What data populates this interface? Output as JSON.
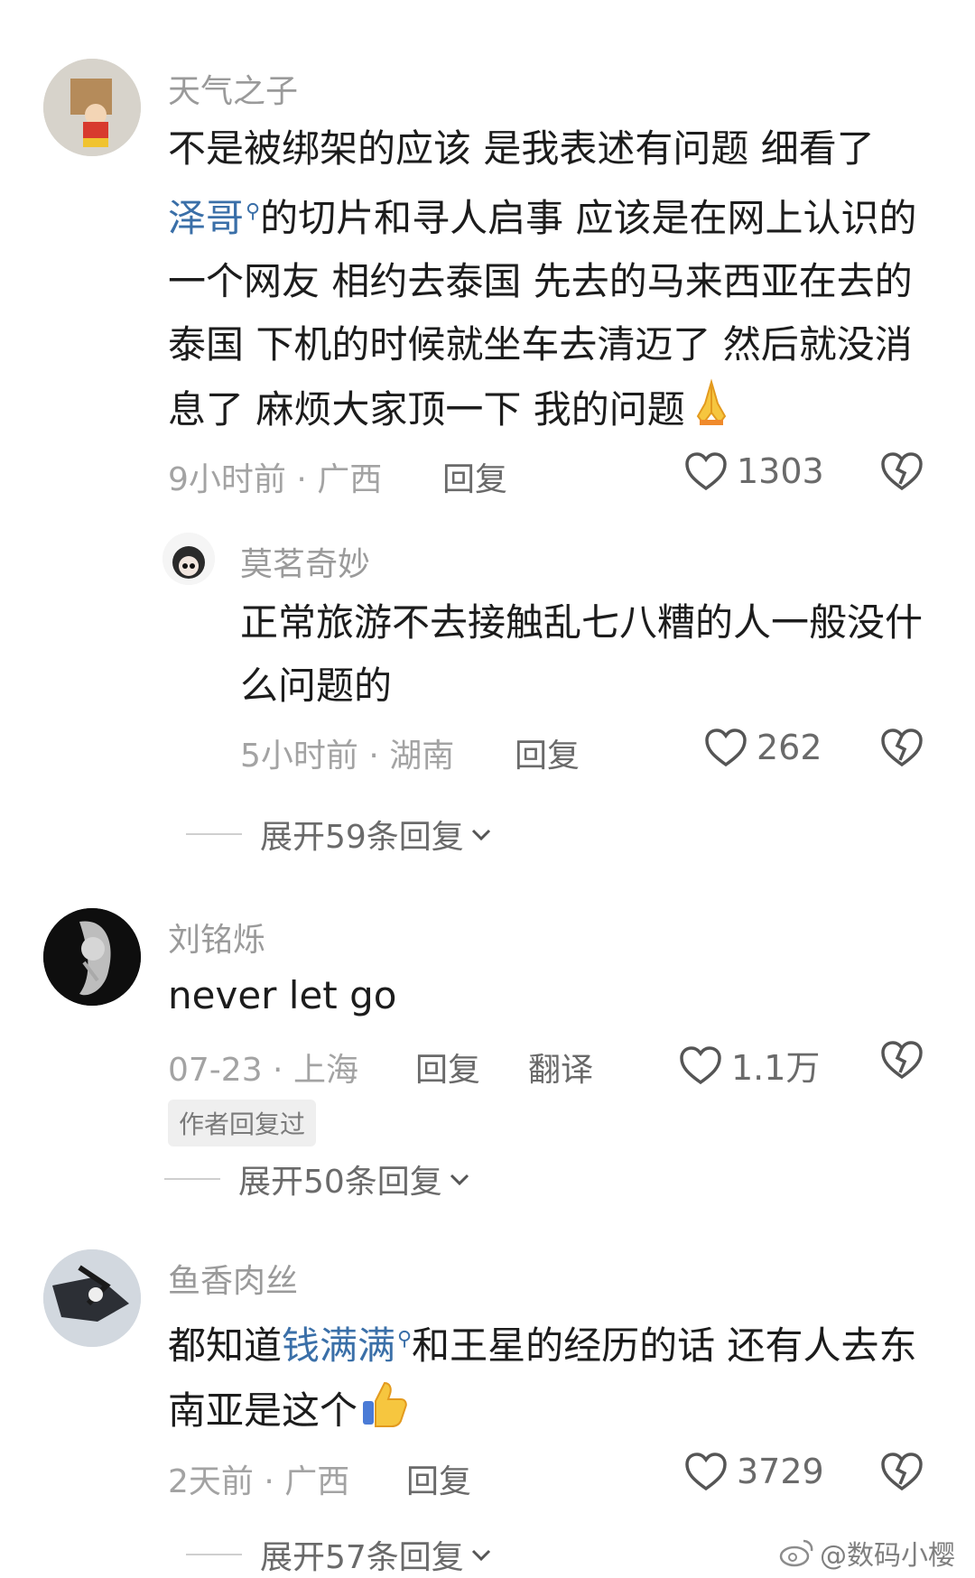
{
  "comments": [
    {
      "username": "天气之子",
      "text_before": "不是被绑架的应该 是我表述有问题 细看了",
      "mention": "泽哥",
      "text_after": "的切片和寻人启事 应该是在网上认识的一个网友 相约去泰国  先去的马来西亚在去的泰国 下机的时候就坐车去清迈了 然后就没消息了 麻烦大家顶一下 我的问题",
      "emoji": "pray-emoji",
      "meta": "9小时前 · 广西",
      "reply_label": "回复",
      "likes": "1303"
    },
    {
      "username": "莫茗奇妙",
      "text": "正常旅游不去接触乱七八糟的人一般没什么问题的",
      "meta": "5小时前 · 湖南",
      "reply_label": "回复",
      "likes": "262",
      "expand_label": "展开59条回复"
    },
    {
      "username": "刘铭烁",
      "text": "never let go",
      "meta": "07-23 · 上海",
      "reply_label": "回复",
      "translate_label": "翻译",
      "likes": "1.1万",
      "author_tag": "作者回复过",
      "expand_label": "展开50条回复"
    },
    {
      "username": "鱼香肉丝",
      "text_before": "都知道",
      "mention": "钱满满",
      "text_after": "和王星的经历的话 还有人去东南亚是这个",
      "emoji": "thumbs-up-emoji",
      "meta": "2天前 · 广西",
      "reply_label": "回复",
      "likes": "3729",
      "expand_label": "展开57条回复"
    }
  ],
  "watermark": "@数码小樱",
  "colors": {
    "mention": "#3a6fa8",
    "meta": "#a3a3a3",
    "text": "#1c1c1c"
  }
}
